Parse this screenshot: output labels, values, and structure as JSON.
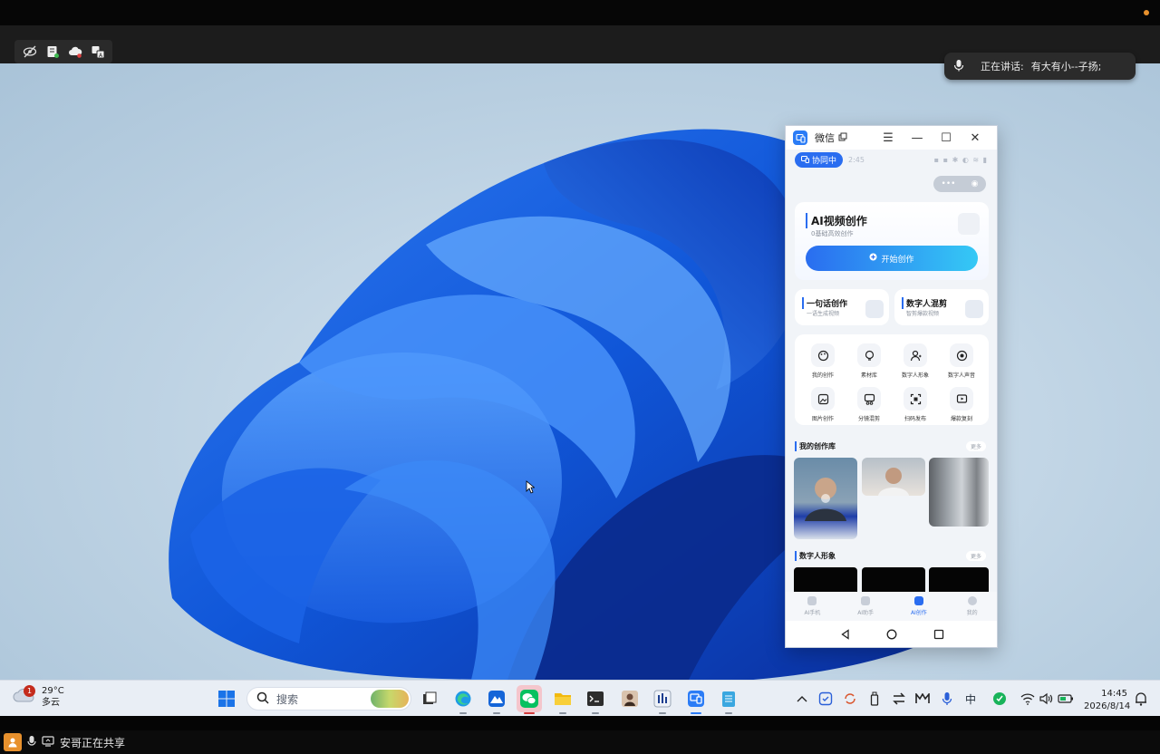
{
  "meeting": {
    "speaking_label": "正在讲话:",
    "speaker_name": "有大有小--子扬;",
    "share_status": "安哥正在共享"
  },
  "phone_window": {
    "title": "微信",
    "collab_label": "协同中",
    "status_time": "2:45",
    "hero": {
      "title": "AI视频创作",
      "subtitle": "0基础高效创作",
      "button": "开始创作"
    },
    "quick_cards": [
      {
        "title": "一句话创作",
        "subtitle": "一语生成视频"
      },
      {
        "title": "数字人混剪",
        "subtitle": "智剪爆款视频"
      }
    ],
    "grid": [
      {
        "label": "我的创作",
        "icon": "palette-icon"
      },
      {
        "label": "素材库",
        "icon": "bulb-icon"
      },
      {
        "label": "数字人形象",
        "icon": "user-add-icon"
      },
      {
        "label": "数字人声音",
        "icon": "sound-icon"
      },
      {
        "label": "图片创作",
        "icon": "image-icon"
      },
      {
        "label": "分镜混剪",
        "icon": "scissors-icon"
      },
      {
        "label": "扫码发布",
        "icon": "scan-icon"
      },
      {
        "label": "爆款复刻",
        "icon": "video-icon"
      }
    ],
    "library_title": "我的创作库",
    "avatar_title": "数字人形象",
    "more_label": "更多",
    "nav": [
      {
        "label": "AI手机",
        "active": false
      },
      {
        "label": "AI助手",
        "active": false
      },
      {
        "label": "AI创作",
        "active": true
      },
      {
        "label": "我的",
        "active": false
      }
    ]
  },
  "taskbar": {
    "weather": {
      "temp": "29°C",
      "desc": "多云",
      "badge": "1"
    },
    "search_placeholder": "搜索",
    "ime": "中",
    "time": "14:45",
    "date": "2026/8/14"
  },
  "colors": {
    "accent": "#2a6df0",
    "recording": "#e8912d"
  }
}
